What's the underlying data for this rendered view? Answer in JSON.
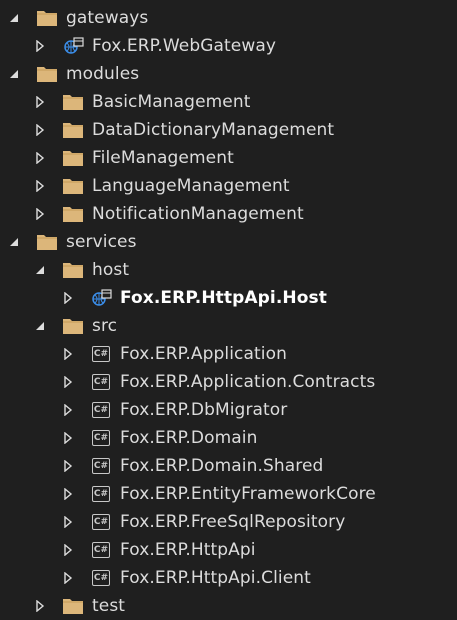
{
  "tree": {
    "rows": [
      {
        "label": "gateways",
        "icon": "folder-icon",
        "expander": "expanded"
      },
      {
        "label": "Fox.ERP.WebGateway",
        "icon": "web-project-icon",
        "expander": "collapsed"
      },
      {
        "label": "modules",
        "icon": "folder-icon",
        "expander": "expanded"
      },
      {
        "label": "BasicManagement",
        "icon": "folder-icon",
        "expander": "collapsed"
      },
      {
        "label": "DataDictionaryManagement",
        "icon": "folder-icon",
        "expander": "collapsed"
      },
      {
        "label": "FileManagement",
        "icon": "folder-icon",
        "expander": "collapsed"
      },
      {
        "label": "LanguageManagement",
        "icon": "folder-icon",
        "expander": "collapsed"
      },
      {
        "label": "NotificationManagement",
        "icon": "folder-icon",
        "expander": "collapsed"
      },
      {
        "label": "services",
        "icon": "folder-icon",
        "expander": "expanded"
      },
      {
        "label": "host",
        "icon": "folder-icon",
        "expander": "expanded"
      },
      {
        "label": "Fox.ERP.HttpApi.Host",
        "icon": "web-project-icon",
        "expander": "collapsed",
        "startup": true
      },
      {
        "label": "src",
        "icon": "folder-icon",
        "expander": "expanded"
      },
      {
        "label": "Fox.ERP.Application",
        "icon": "csharp-project-icon",
        "expander": "collapsed"
      },
      {
        "label": "Fox.ERP.Application.Contracts",
        "icon": "csharp-project-icon",
        "expander": "collapsed"
      },
      {
        "label": "Fox.ERP.DbMigrator",
        "icon": "csharp-project-icon",
        "expander": "collapsed"
      },
      {
        "label": "Fox.ERP.Domain",
        "icon": "csharp-project-icon",
        "expander": "collapsed"
      },
      {
        "label": "Fox.ERP.Domain.Shared",
        "icon": "csharp-project-icon",
        "expander": "collapsed"
      },
      {
        "label": "Fox.ERP.EntityFrameworkCore",
        "icon": "csharp-project-icon",
        "expander": "collapsed"
      },
      {
        "label": "Fox.ERP.FreeSqlRepository",
        "icon": "csharp-project-icon",
        "expander": "collapsed"
      },
      {
        "label": "Fox.ERP.HttpApi",
        "icon": "csharp-project-icon",
        "expander": "collapsed"
      },
      {
        "label": "Fox.ERP.HttpApi.Client",
        "icon": "csharp-project-icon",
        "expander": "collapsed"
      },
      {
        "label": "test",
        "icon": "folder-icon",
        "expander": "collapsed"
      }
    ],
    "csharp_glyph": "C#"
  },
  "colors": {
    "background": "#1f1f1f",
    "text": "#dcdcdc",
    "folder": "#dcb67a",
    "folder_dark": "#c49a56",
    "web_icon": "#3b8eea"
  }
}
